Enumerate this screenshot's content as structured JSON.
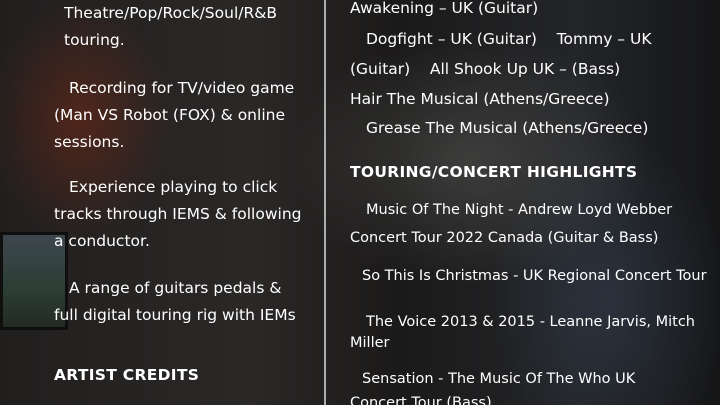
{
  "left_column": {
    "skills": [
      {
        "lines": [
          "Theatre/Pop/Rock/Soul/R&B",
          "touring."
        ]
      },
      {
        "lines": [
          "Recording for TV/video game",
          "(Man VS Robot (FOX) & online",
          "sessions."
        ]
      },
      {
        "lines": [
          "Experience playing to click",
          "tracks through IEMS & following",
          "a conductor."
        ]
      },
      {
        "lines": [
          "A range of guitars pedals &",
          "full digital touring rig with IEMs"
        ]
      }
    ],
    "artist_credits_heading": "ARTIST CREDITS"
  },
  "right_column": {
    "theatre_lines": [
      "Awakening – UK (Guitar)",
      "Dogfight – UK (Guitar)    Tommy – UK",
      "(Guitar)    All Shook Up UK – (Bass)",
      "Hair The Musical (Athens/Greece)",
      "Grease The Musical (Athens/Greece)"
    ],
    "touring_heading": "TOURING/CONCERT HIGHLIGHTS",
    "touring_items": [
      {
        "lines": [
          "Music Of The Night - Andrew Loyd Webber",
          "Concert Tour 2022 Canada (Guitar & Bass)"
        ]
      },
      {
        "lines": [
          "So This Is Christmas - UK Regional Concert Tour"
        ]
      },
      {
        "lines": [
          "The Voice 2013 & 2015 - Leanne Jarvis, Mitch",
          "Miller"
        ]
      },
      {
        "lines": [
          "Sensation - The Music Of The Who UK",
          "Concert Tour (Bass)"
        ]
      }
    ]
  }
}
